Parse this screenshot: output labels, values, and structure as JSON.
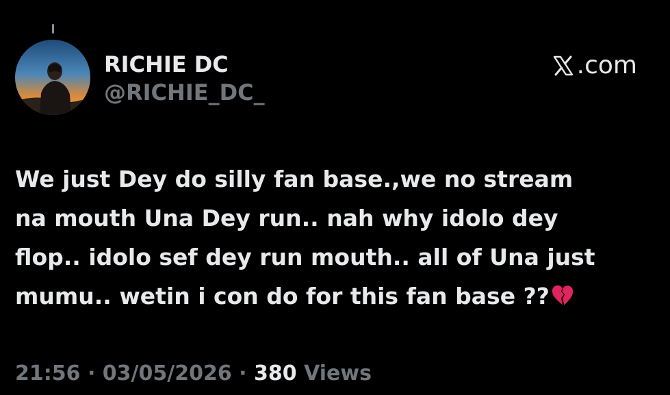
{
  "author": {
    "display_name": "RICHIE DC",
    "handle": "@RICHIE_DC_"
  },
  "brand": {
    "label": ".com",
    "icon": "x-logo-icon"
  },
  "tweet": {
    "text": "We just Dey do silly fan base.,we no stream\nna mouth Una Dey run.. nah why idolo dey\nflop.. idolo sef dey run mouth.. all of Una just\nmumu.. wetin i con do for this fan base ??",
    "emoji": "broken-heart-icon"
  },
  "meta": {
    "time": "21:56",
    "separator_1": " · ",
    "date": "03/05/2026",
    "separator_2": " · ",
    "views_count": "380",
    "views_label": " Views"
  },
  "colors": {
    "background": "#000000",
    "primary_text": "#e7e9ea",
    "secondary_text": "#71767b",
    "heart_red": "#e0245e"
  }
}
